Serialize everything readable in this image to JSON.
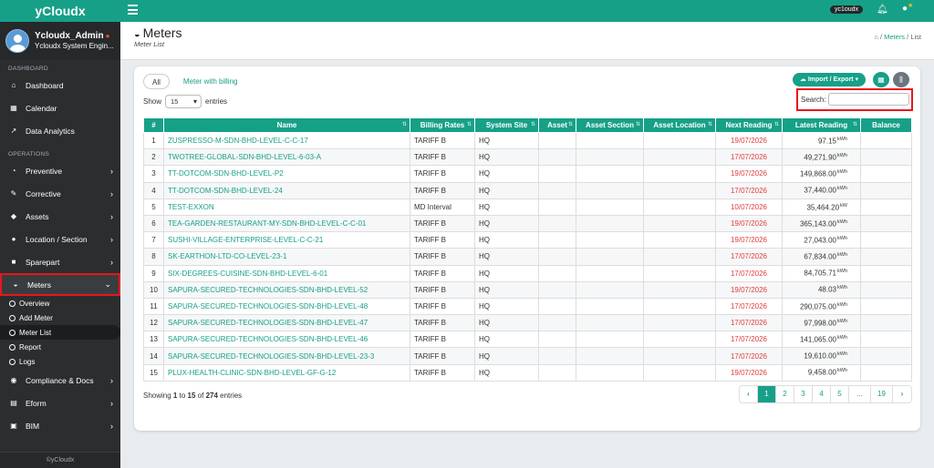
{
  "app": {
    "brand": "yCloudx",
    "footer": "©yCloudx"
  },
  "user": {
    "name": "Ycloudx_Admin",
    "role": "Ycloudx System Engin..."
  },
  "topbar": {
    "user_badge": "yc1oudx"
  },
  "sidebar": {
    "sections": {
      "dashboard": "DASHBOARD",
      "operations": "OPERATIONS"
    },
    "dashboard_items": [
      {
        "label": "Dashboard",
        "icon": "home-icon"
      },
      {
        "label": "Calendar",
        "icon": "calendar-icon"
      },
      {
        "label": "Data Analytics",
        "icon": "chart-icon"
      }
    ],
    "ops_items": [
      {
        "label": "Preventive"
      },
      {
        "label": "Corrective"
      },
      {
        "label": "Assets"
      },
      {
        "label": "Location / Section"
      },
      {
        "label": "Sparepart"
      },
      {
        "label": "Meters"
      }
    ],
    "meter_sub": [
      "Overview",
      "Add Meter",
      "Meter List",
      "Report",
      "Logs"
    ],
    "bottom_items": [
      {
        "label": "Compliance & Docs"
      },
      {
        "label": "Eform"
      },
      {
        "label": "BIM"
      }
    ]
  },
  "page": {
    "title": "Meters",
    "subtitle": "Meter List",
    "breadcrumb": {
      "meters": "Meters",
      "list": "List"
    }
  },
  "tabs": {
    "all": "All",
    "billing": "Meter with billing"
  },
  "toolbar": {
    "import_label": "Import / Export"
  },
  "controls": {
    "show_label": "Show",
    "entries_label": "entries",
    "page_size": "15",
    "search_label": "Search:",
    "search_value": ""
  },
  "table": {
    "headers": [
      "#",
      "Name",
      "Billing Rates",
      "System Site",
      "Asset",
      "Asset Section",
      "Asset Location",
      "Next Reading",
      "Latest Reading",
      "Balance"
    ],
    "rows": [
      {
        "no": "1",
        "name": "ZUSPRESSO-M-SDN-BHD-LEVEL-C-C-17",
        "rate": "TARIFF B",
        "site": "HQ",
        "next": "19/07/2026",
        "latest": "97.15",
        "unit": "kWh"
      },
      {
        "no": "2",
        "name": "TWOTREE-GLOBAL-SDN-BHD-LEVEL-6-03-A",
        "rate": "TARIFF B",
        "site": "HQ",
        "next": "17/07/2026",
        "latest": "49,271.90",
        "unit": "kWh"
      },
      {
        "no": "3",
        "name": "TT-DOTCOM-SDN-BHD-LEVEL-P2",
        "rate": "TARIFF B",
        "site": "HQ",
        "next": "19/07/2026",
        "latest": "149,868.00",
        "unit": "kWh"
      },
      {
        "no": "4",
        "name": "TT-DOTCOM-SDN-BHD-LEVEL-24",
        "rate": "TARIFF B",
        "site": "HQ",
        "next": "17/07/2026",
        "latest": "37,440.00",
        "unit": "kWh"
      },
      {
        "no": "5",
        "name": "TEST-EXXON",
        "rate": "MD Interval",
        "site": "HQ",
        "next": "10/07/2026",
        "latest": "35,464.20",
        "unit": "kW"
      },
      {
        "no": "6",
        "name": "TEA-GARDEN-RESTAURANT-MY-SDN-BHD-LEVEL-C-C-01",
        "rate": "TARIFF B",
        "site": "HQ",
        "next": "19/07/2026",
        "latest": "365,143.00",
        "unit": "kWh"
      },
      {
        "no": "7",
        "name": "SUSHI-VILLAGE-ENTERPRISE-LEVEL-C-C-21",
        "rate": "TARIFF B",
        "site": "HQ",
        "next": "19/07/2026",
        "latest": "27,043.00",
        "unit": "kWh"
      },
      {
        "no": "8",
        "name": "SK-EARTHON-LTD-CO-LEVEL-23-1",
        "rate": "TARIFF B",
        "site": "HQ",
        "next": "17/07/2026",
        "latest": "67,834.00",
        "unit": "kWh"
      },
      {
        "no": "9",
        "name": "SIX-DEGREES-CUISINE-SDN-BHD-LEVEL-6-01",
        "rate": "TARIFF B",
        "site": "HQ",
        "next": "17/07/2026",
        "latest": "84,705.71",
        "unit": "kWh"
      },
      {
        "no": "10",
        "name": "SAPURA-SECURED-TECHNOLOGIES-SDN-BHD-LEVEL-52",
        "rate": "TARIFF B",
        "site": "HQ",
        "next": "19/07/2026",
        "latest": "48.03",
        "unit": "kWh"
      },
      {
        "no": "11",
        "name": "SAPURA-SECURED-TECHNOLOGIES-SDN-BHD-LEVEL-48",
        "rate": "TARIFF B",
        "site": "HQ",
        "next": "17/07/2026",
        "latest": "290,075.00",
        "unit": "kWh"
      },
      {
        "no": "12",
        "name": "SAPURA-SECURED-TECHNOLOGIES-SDN-BHD-LEVEL-47",
        "rate": "TARIFF B",
        "site": "HQ",
        "next": "17/07/2026",
        "latest": "97,998.00",
        "unit": "kWh"
      },
      {
        "no": "13",
        "name": "SAPURA-SECURED-TECHNOLOGIES-SDN-BHD-LEVEL-46",
        "rate": "TARIFF B",
        "site": "HQ",
        "next": "17/07/2026",
        "latest": "141,065.00",
        "unit": "kWh"
      },
      {
        "no": "14",
        "name": "SAPURA-SECURED-TECHNOLOGIES-SDN-BHD-LEVEL-23-3",
        "rate": "TARIFF B",
        "site": "HQ",
        "next": "17/07/2026",
        "latest": "19,610.00",
        "unit": "kWh"
      },
      {
        "no": "15",
        "name": "PLUX-HEALTH-CLINIC-SDN-BHD-LEVEL-GF-G-12",
        "rate": "TARIFF B",
        "site": "HQ",
        "next": "19/07/2026",
        "latest": "9,458.00",
        "unit": "kWh"
      }
    ]
  },
  "footer_info": {
    "prefix": "Showing",
    "from": "1",
    "to_word": "to",
    "to": "15",
    "of_word": "of",
    "total": "274",
    "suffix": "entries"
  },
  "pagination": {
    "prev": "‹",
    "pages": [
      "1",
      "2",
      "3",
      "4",
      "5",
      "...",
      "19"
    ],
    "next": "›",
    "active": "1"
  },
  "colors": {
    "brand": "#17a088",
    "highlight": "#e8161c",
    "date_red": "#e04040"
  }
}
